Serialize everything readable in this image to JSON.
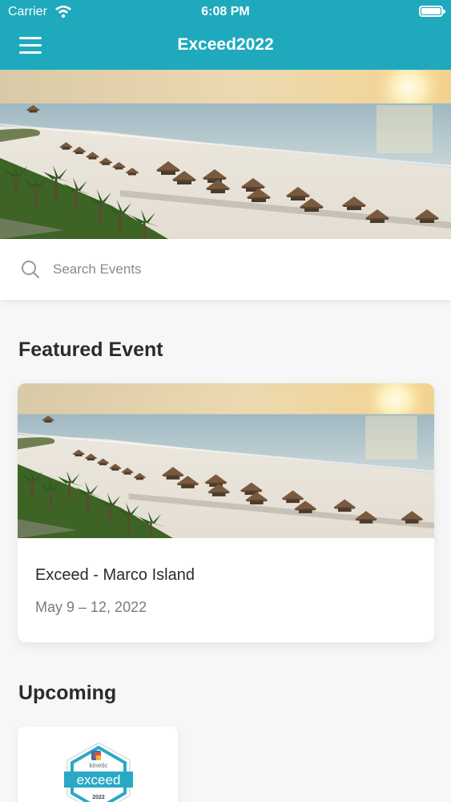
{
  "status_bar": {
    "carrier": "Carrier",
    "time": "6:08 PM"
  },
  "nav": {
    "title": "Exceed2022",
    "menu_icon": "hamburger-menu-icon"
  },
  "search": {
    "placeholder": "Search Events",
    "icon": "search-icon"
  },
  "featured": {
    "heading": "Featured Event",
    "event": {
      "name": "Exceed - Marco Island",
      "date": "May 9 – 12, 2022"
    }
  },
  "upcoming": {
    "heading": "Upcoming",
    "events": [
      {
        "logo_brand": "kinetic",
        "logo_word": "exceed",
        "logo_year": "2022"
      }
    ]
  },
  "colors": {
    "brand": "#1fa9bd",
    "background": "#f7f7f8",
    "text": "#2b2b2f",
    "muted": "#7a7a7f"
  }
}
